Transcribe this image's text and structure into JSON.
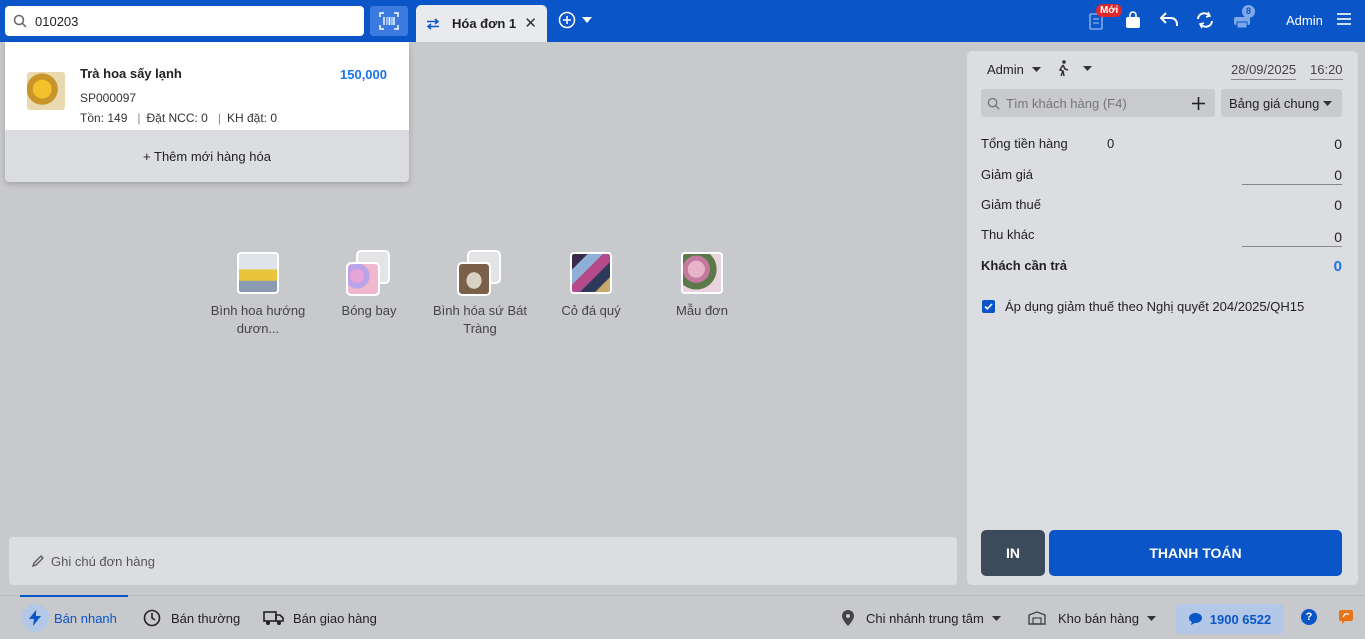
{
  "search": {
    "value": "010203",
    "placeholder": ""
  },
  "tabs": [
    {
      "label": "Hóa đơn 1"
    }
  ],
  "header": {
    "new_badge": "Mới",
    "notif_count": "8",
    "user": "Admin"
  },
  "search_results": {
    "items": [
      {
        "name": "Trà hoa sấy lạnh",
        "price": "150,000",
        "code": "SP000097",
        "stock": "Tồn: 149",
        "supplier_order": "Đặt NCC: 0",
        "customer_order": "KH đặt: 0"
      }
    ],
    "add_new_label": "+ Thêm mới hàng hóa"
  },
  "categories": [
    {
      "label": "Bình hoa hướng dươn..."
    },
    {
      "label": "Bóng bay"
    },
    {
      "label": "Bình hóa sứ Bát Tràng"
    },
    {
      "label": "Cỏ đá quý"
    },
    {
      "label": "Mẫu đơn"
    }
  ],
  "note": {
    "placeholder": "Ghi chú đơn hàng"
  },
  "panel": {
    "seller": "Admin",
    "date": "28/09/2025",
    "time": "16:20",
    "customer_search_placeholder": "Tìm khách hàng (F4)",
    "price_list": "Bảng giá chung",
    "total_label": "Tổng tiền hàng",
    "total_qty": "0",
    "total_value": "0",
    "discount_label": "Giảm giá",
    "discount_value": "0",
    "tax_reduction_label": "Giảm thuế",
    "tax_reduction_value": "0",
    "other_income_label": "Thu khác",
    "other_income_value": "0",
    "to_pay_label": "Khách cần trả",
    "to_pay_value": "0",
    "apply_tax_label": "Áp dụng giảm thuế theo Nghị quyết 204/2025/QH15",
    "apply_tax_checked": true,
    "print_label": "IN",
    "pay_label": "THANH TOÁN"
  },
  "bottom": {
    "modes": [
      {
        "label": "Bán nhanh"
      },
      {
        "label": "Bán thường"
      },
      {
        "label": "Bán giao hàng"
      }
    ],
    "branch": "Chi nhánh trung tâm",
    "warehouse": "Kho bán hàng",
    "hotline": "1900 6522"
  },
  "colors": {
    "primary": "#0a55c7",
    "price": "#1a73e8",
    "badge": "#e0282c"
  }
}
